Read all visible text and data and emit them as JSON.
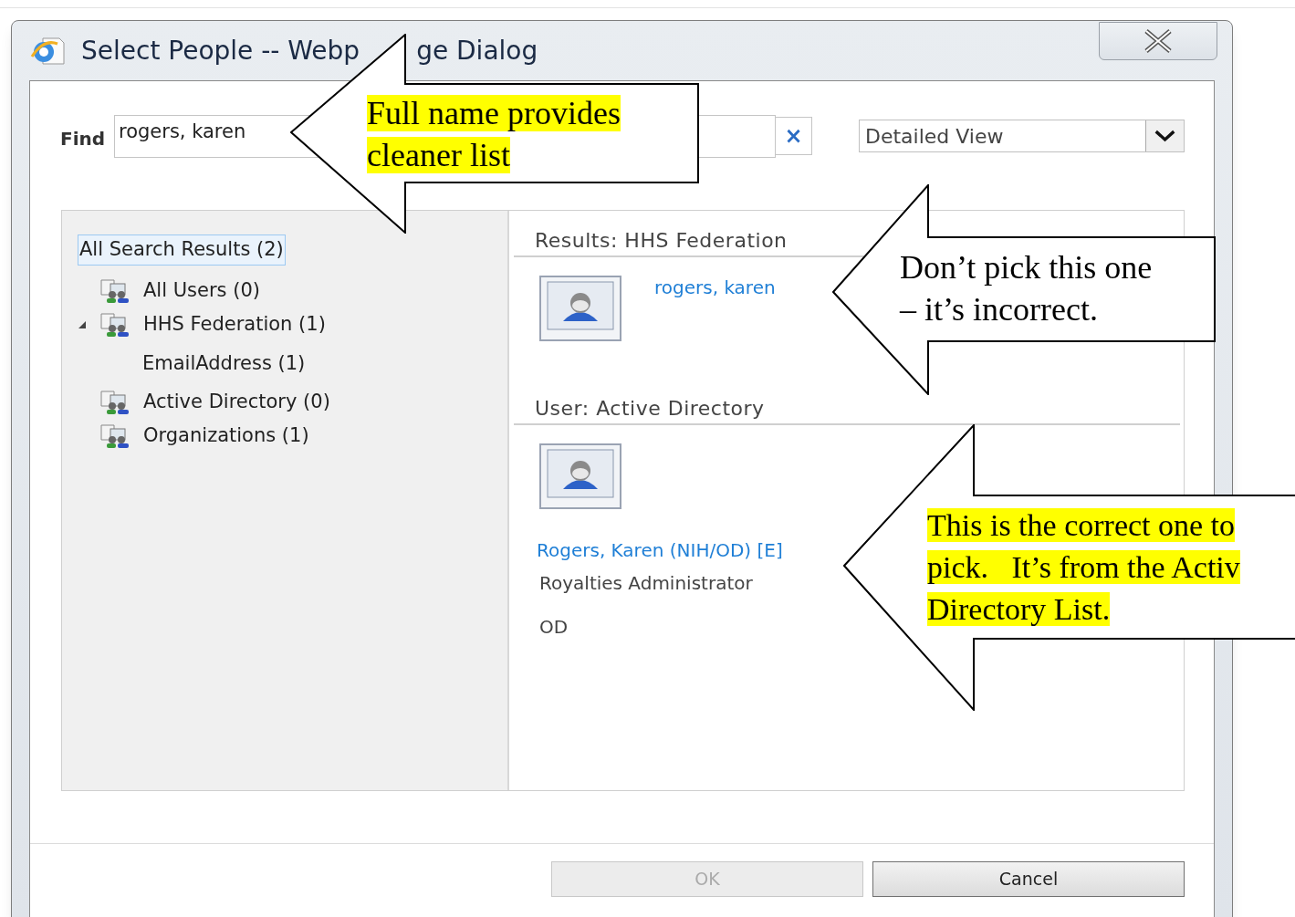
{
  "window": {
    "title_parts": [
      "Select People -- Webp",
      "ge Dialog"
    ]
  },
  "find": {
    "label": "Find",
    "value": "rogers, karen",
    "clear": "×"
  },
  "view_select": {
    "value": "Detailed View"
  },
  "tree": {
    "root": {
      "label": "All Search Results (2)",
      "selected": true
    },
    "items": [
      {
        "label": "All Users (0)",
        "expanded": false
      },
      {
        "label": "HHS Federation (1)",
        "expanded": true,
        "children": [
          {
            "label": "EmailAddress (1)"
          }
        ]
      },
      {
        "label": "Active Directory (0)",
        "expanded": false
      },
      {
        "label": "Organizations (1)",
        "expanded": false
      }
    ]
  },
  "results": [
    {
      "heading": "Results: HHS Federation",
      "people": [
        {
          "kind": "compact",
          "name": "rogers, karen"
        }
      ]
    },
    {
      "heading": "User: Active Directory",
      "people": [
        {
          "kind": "detailed",
          "name": "Rogers, Karen (NIH/OD) [E]",
          "job_title": "Royalties Administrator",
          "department": "OD"
        }
      ]
    }
  ],
  "buttons": [
    {
      "label": "OK",
      "disabled": true
    },
    {
      "label": "Cancel",
      "disabled": false
    }
  ],
  "callouts": [
    {
      "lines": [
        "Full name provides",
        "cleaner list"
      ],
      "highlighted": true
    },
    {
      "lines": [
        "Don’t pick this one",
        "– it’s incorrect."
      ],
      "highlighted": false
    },
    {
      "lines": [
        "This is the correct one to",
        "pick.   It’s from the Activ",
        "Directory List."
      ],
      "highlighted": true
    }
  ]
}
